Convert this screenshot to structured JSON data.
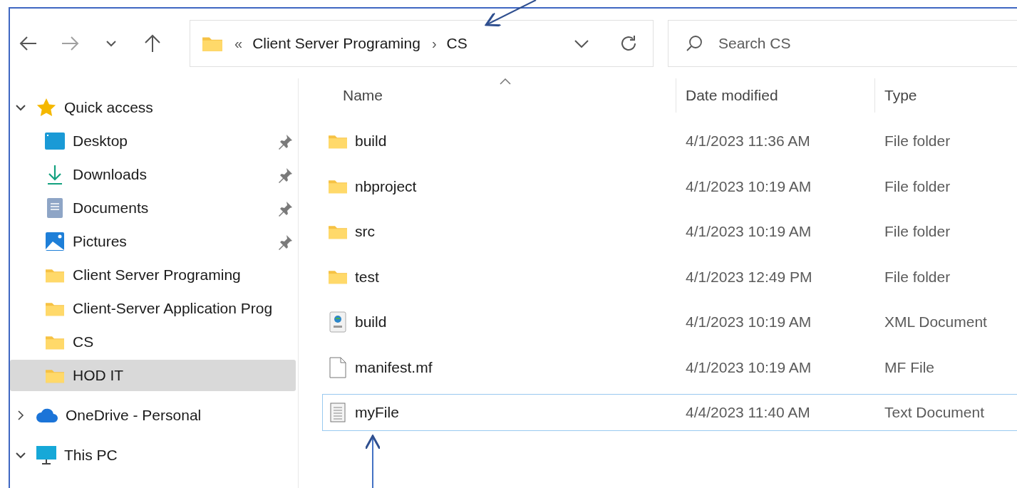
{
  "toolbar": {
    "buttons": [
      {
        "kind": "back",
        "disabled": false
      },
      {
        "kind": "forward",
        "disabled": true
      },
      {
        "kind": "recent",
        "disabled": false
      },
      {
        "kind": "up",
        "disabled": false
      }
    ]
  },
  "address_bar": {
    "overflow": "«",
    "path": [
      "Client Server Programing",
      "CS"
    ],
    "separator": "›"
  },
  "search": {
    "placeholder": "Search CS"
  },
  "sidebar": {
    "items": [
      {
        "label": "Quick access",
        "kind": "star",
        "expanded": true,
        "children": [
          {
            "label": "Desktop",
            "kind": "desktop",
            "pinned": true,
            "selected": false
          },
          {
            "label": "Downloads",
            "kind": "downloads",
            "pinned": true,
            "selected": false
          },
          {
            "label": "Documents",
            "kind": "documents",
            "pinned": true,
            "selected": false
          },
          {
            "label": "Pictures",
            "kind": "pictures",
            "pinned": true,
            "selected": false
          },
          {
            "label": "Client Server Programing",
            "kind": "folder",
            "pinned": false,
            "selected": false
          },
          {
            "label": "Client-Server Application Prog",
            "kind": "folder",
            "pinned": false,
            "selected": false
          },
          {
            "label": "CS",
            "kind": "folder",
            "pinned": false,
            "selected": false
          },
          {
            "label": "HOD IT",
            "kind": "folder",
            "pinned": false,
            "selected": true
          }
        ]
      },
      {
        "label": "OneDrive - Personal",
        "kind": "cloud",
        "expanded": false
      },
      {
        "label": "This PC",
        "kind": "pc",
        "expanded": true
      }
    ]
  },
  "table": {
    "columns": [
      {
        "label": "Name",
        "sorted": true
      },
      {
        "label": "Date modified",
        "sorted": false
      },
      {
        "label": "Type",
        "sorted": false
      }
    ],
    "rows": [
      {
        "name": "build",
        "kind": "folder",
        "date": "4/1/2023 11:36 AM",
        "type": "File folder",
        "focused": false
      },
      {
        "name": "nbproject",
        "kind": "folder",
        "date": "4/1/2023 10:19 AM",
        "type": "File folder",
        "focused": false
      },
      {
        "name": "src",
        "kind": "folder",
        "date": "4/1/2023 10:19 AM",
        "type": "File folder",
        "focused": false
      },
      {
        "name": "test",
        "kind": "folder",
        "date": "4/1/2023 12:49 PM",
        "type": "File folder",
        "focused": false
      },
      {
        "name": "build",
        "kind": "xml",
        "date": "4/1/2023 10:19 AM",
        "type": "XML Document",
        "focused": false
      },
      {
        "name": "manifest.mf",
        "kind": "file",
        "date": "4/1/2023 10:19 AM",
        "type": "MF File",
        "focused": false
      },
      {
        "name": "myFile",
        "kind": "text",
        "date": "4/4/2023 11:40 AM",
        "type": "Text Document",
        "focused": true
      }
    ]
  }
}
